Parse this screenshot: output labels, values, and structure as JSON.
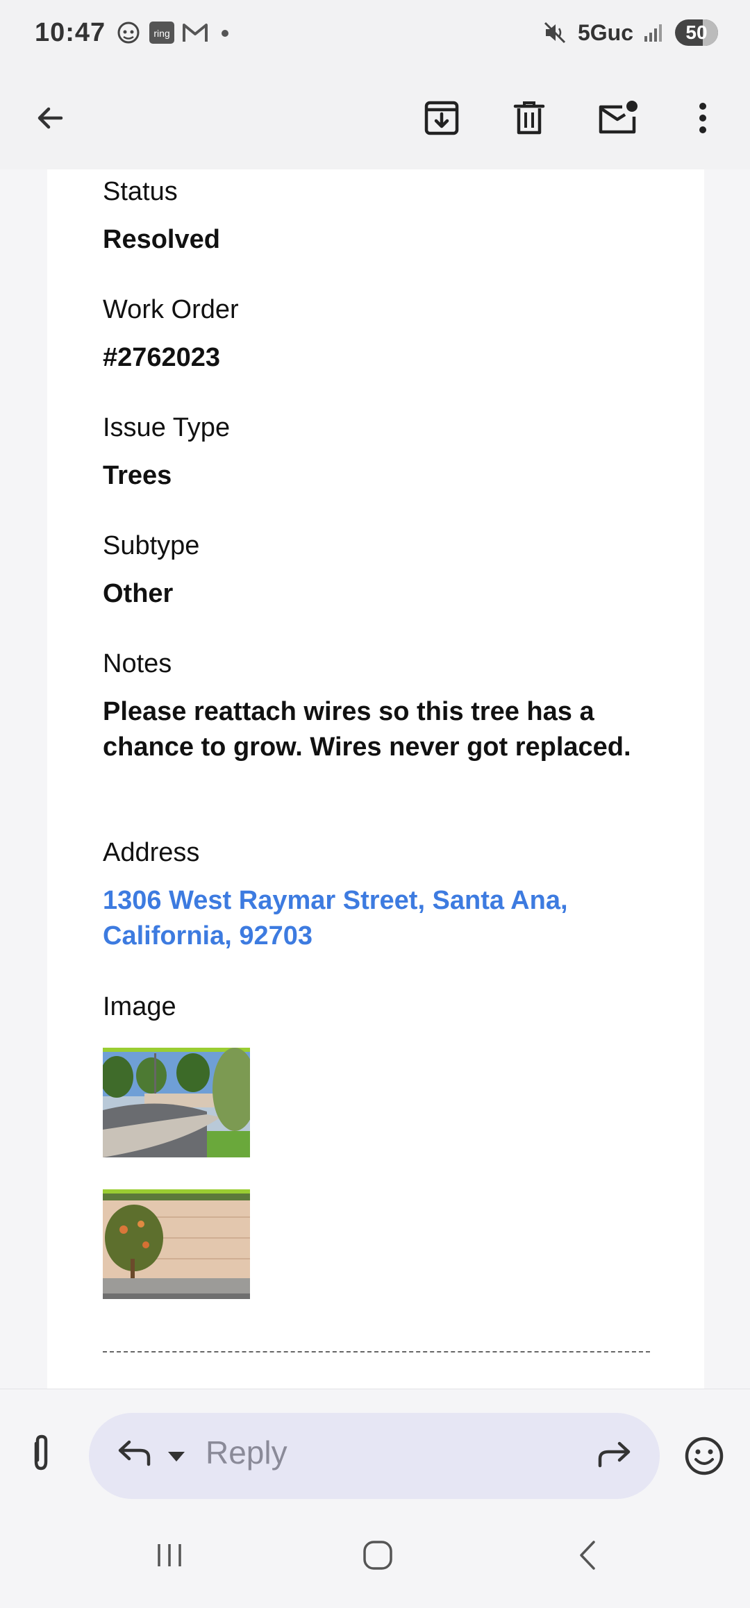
{
  "status_bar": {
    "time": "10:47",
    "notification_icons": [
      "ring-icon",
      "gmail-icon"
    ],
    "network": "5Guc",
    "battery": "50"
  },
  "toolbar": {
    "icons": [
      "back-arrow-icon",
      "archive-icon",
      "delete-icon",
      "mark-unread-icon",
      "more-vert-icon"
    ]
  },
  "email": {
    "fields": [
      {
        "label": "Status",
        "value": "Resolved"
      },
      {
        "label": "Work Order",
        "value": "#2762023"
      },
      {
        "label": "Issue Type",
        "value": "Trees"
      },
      {
        "label": "Subtype",
        "value": "Other"
      },
      {
        "label": "Notes",
        "value": "Please reattach wires so this tree has a chance to grow. Wires never got replaced."
      },
      {
        "label": "Address",
        "value": "1306 West Raymar Street, Santa Ana, California, 92703"
      },
      {
        "label": "Image",
        "value": ""
      }
    ],
    "link_color": "#3d7be0"
  },
  "reply_bar": {
    "placeholder": "Reply"
  }
}
